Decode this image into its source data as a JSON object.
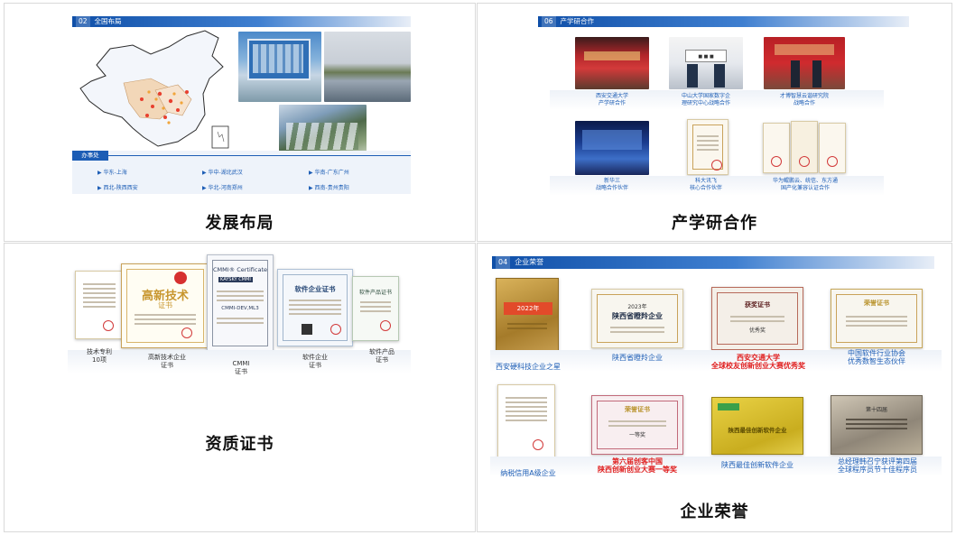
{
  "q1": {
    "bar_num": "02",
    "bar_title": "全国布局",
    "office_tag": "办事处",
    "offices": [
      "华东-上海",
      "华中-湖北武汉",
      "华南-广东广州",
      "西北-陕西西安",
      "华北-河南郑州",
      "西南-贵州贵阳"
    ],
    "title": "发展布局"
  },
  "q2": {
    "bar_num": "06",
    "bar_title": "产学研合作",
    "top_caps": [
      [
        "西安交通大学",
        "产学研合作"
      ],
      [
        "中山大学国家数字企",
        "理研究中心战略合作"
      ],
      [
        "才博智慧云谐研究院",
        "战略合作"
      ]
    ],
    "bottom_caps": [
      [
        "新华三",
        "战略合作伙伴"
      ],
      [
        "科大讯飞",
        "核心合作伙伴"
      ],
      [
        "华为鲲鹏云、统信、东方通",
        "国产化兼容认证合作"
      ]
    ],
    "title": "产学研合作"
  },
  "q3": {
    "labels": [
      [
        "技术专利",
        "10项"
      ],
      [
        "高新技术企业",
        "证书"
      ],
      [
        "CMMI",
        "证书"
      ],
      [
        "软件企业",
        "证书"
      ],
      [
        "软件产品",
        "证书"
      ]
    ],
    "cert_texts": {
      "hitech": "高新技术",
      "hitech_sub": "证书",
      "cmmi_title": "CMMI® Certificate",
      "cmmi_brand": "KAYSKY CMMI",
      "cmmi_level": "CMMI-DEV,ML3",
      "soft": "软件企业证书",
      "product": "软件产品证书"
    },
    "title": "资质证书"
  },
  "q4": {
    "bar_num": "04",
    "bar_title": "企业荣誉",
    "row1": [
      {
        "text": "2022年",
        "cap1": "西安硬科技企业之星",
        "cap2": ""
      },
      {
        "text": "2023年",
        "sub": "陕西省瞪羚企业",
        "cap1": "陕西省瞪羚企业",
        "cap2": ""
      },
      {
        "text": "获奖证书",
        "sub": "优秀奖",
        "cap1": "西安交通大学",
        "cap2": "全球校友创新创业大赛优秀奖"
      },
      {
        "text": "荣誉证书",
        "cap1": "中国软件行业协会",
        "cap2": "优秀数智生态伙伴"
      }
    ],
    "row2": [
      {
        "cap1": "纳税信用A级企业",
        "cap2": ""
      },
      {
        "text": "荣誉证书",
        "sub": "一等奖",
        "cap1": "第六届创客中国",
        "cap2": "陕西创新创业大赛一等奖"
      },
      {
        "text": "陕西最佳创新软件企业",
        "cap1": "陕西最佳创新软件企业",
        "cap2": ""
      },
      {
        "text": "第十四届",
        "cap1": "总经理韩召宁获评第四届",
        "cap2": "全球程序员节十佳程序员"
      }
    ],
    "title": "企业荣誉"
  },
  "colors": {
    "brand_blue": "#0f4fa8",
    "caption_blue": "#1c5db5",
    "award_red": "#e02020"
  }
}
